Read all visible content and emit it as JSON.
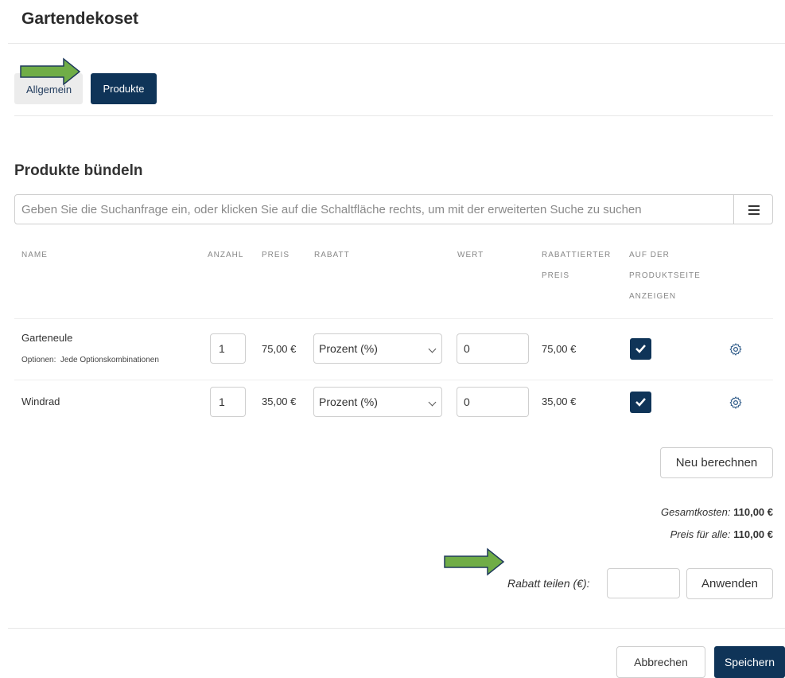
{
  "header": {
    "title": "Gartendekoset"
  },
  "tabs": [
    {
      "label": "Allgemein",
      "active": false
    },
    {
      "label": "Produkte",
      "active": true
    }
  ],
  "section": {
    "title": "Produkte bündeln"
  },
  "search": {
    "placeholder": "Geben Sie die Suchanfrage ein, oder klicken Sie auf die Schaltfläche rechts, um mit der erweiterten Suche zu suchen",
    "value": ""
  },
  "table": {
    "headers": {
      "name": "NAME",
      "anzahl": "ANZAHL",
      "preis": "PREIS",
      "rabatt": "RABATT",
      "wert": "WERT",
      "rabattierter_1": "RABATTIERTER",
      "rabattierter_2": "PREIS",
      "auf_1": "AUF DER",
      "auf_2": "PRODUKTSEITE",
      "auf_3": "ANZEIGEN"
    },
    "rows": [
      {
        "name": "Garteneule",
        "options": "Optionen:  Jede Optionskombinationen",
        "qty": "1",
        "price": "75,00 €",
        "discount_type": "Prozent (%)",
        "value": "0",
        "discounted": "75,00 €",
        "show": true
      },
      {
        "name": "Windrad",
        "options": "",
        "qty": "1",
        "price": "35,00 €",
        "discount_type": "Prozent (%)",
        "value": "0",
        "discounted": "35,00 €",
        "show": true
      }
    ]
  },
  "recalc_label": "Neu berechnen",
  "totals": {
    "gesamt_label": "Gesamtkosten:",
    "gesamt_value": "110,00 €",
    "preis_label": "Preis für alle:",
    "preis_value": "110,00 €"
  },
  "rabatt_teilen": {
    "label": "Rabatt teilen (€):",
    "value": "",
    "apply_label": "Anwenden"
  },
  "footer": {
    "cancel_label": "Abbrechen",
    "save_label": "Speichern"
  },
  "colors": {
    "primary": "#0f3458",
    "arrow_fill": "#70ad47",
    "arrow_stroke": "#1f3a5c"
  },
  "icons": {
    "menu": "hamburger-icon",
    "gear": "gear-icon",
    "check": "check-icon",
    "arrow": "right-arrow-icon"
  }
}
